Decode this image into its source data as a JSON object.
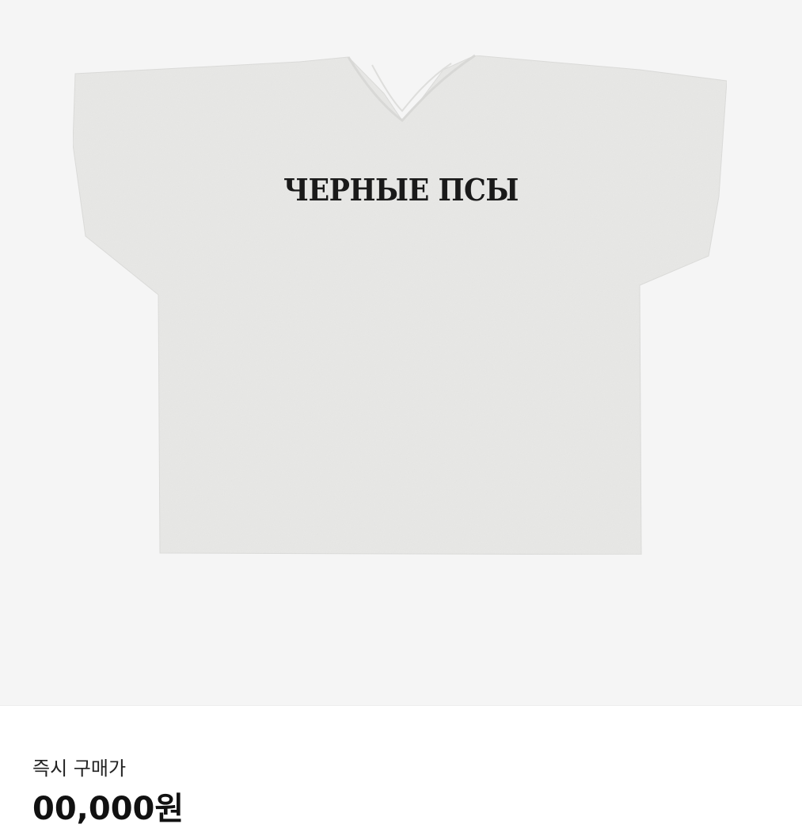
{
  "product": {
    "image_alt": "grey t-shirt",
    "print_text": "ЧЕРНЫЕ ПСЫ",
    "shirt_color": "#e8e8e6",
    "background_color": "#f5f5f5"
  },
  "pricing": {
    "label": "즉시 구매가",
    "value": "00,000원"
  }
}
